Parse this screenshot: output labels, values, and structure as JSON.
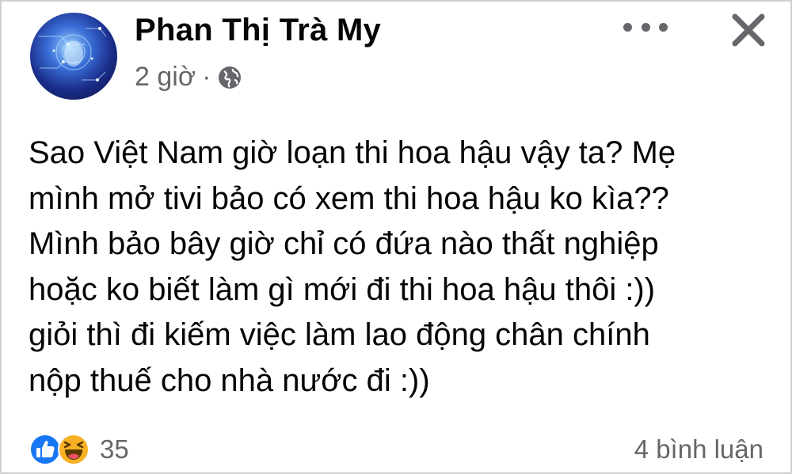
{
  "post": {
    "author": "Phan Thị Trà My",
    "time": "2 giờ",
    "separator": "·",
    "privacy_icon": "globe-icon",
    "text_lines": [
      "Sao Việt Nam giờ loạn thi hoa hậu vậy ta? Mẹ",
      "mình mở tivi bảo có xem thi hoa hậu ko kìa??",
      "Mình bảo bây giờ chỉ có đứa nào thất nghiệp",
      "hoặc ko biết làm gì mới đi thi hoa hậu thôi :))",
      "giỏi thì đi kiếm việc làm lao động chân chính",
      "nộp thuế cho nhà nước đi :))"
    ]
  },
  "header_actions": {
    "more_icon": "more-options-icon",
    "close_icon": "close-icon"
  },
  "footer": {
    "reaction_icons": [
      "like-icon",
      "haha-icon"
    ],
    "reaction_count": "35",
    "comments": "4 bình luận"
  },
  "colors": {
    "primary_text": "#050505",
    "secondary_text": "#65676b",
    "like_blue": "#1877f2",
    "haha_yellow": "#f7b125"
  }
}
